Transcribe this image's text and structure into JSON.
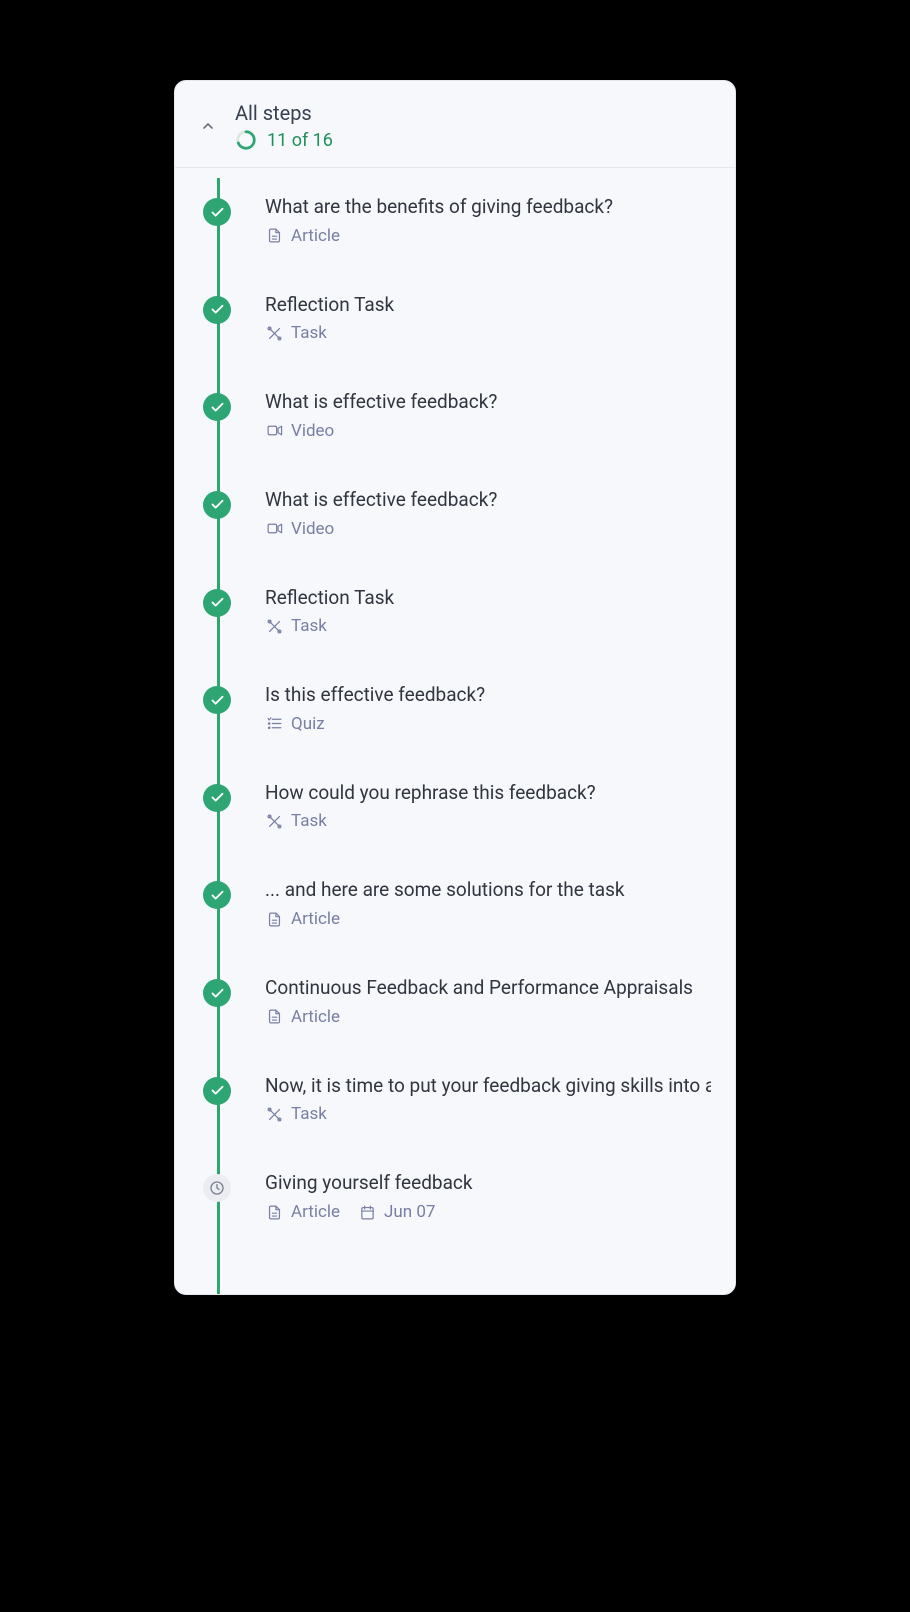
{
  "header": {
    "title": "All steps",
    "progress_label": "11 of 16",
    "progress_completed": 11,
    "progress_total": 16
  },
  "steps": [
    {
      "title": "What are the benefits of giving feedback?",
      "type": "Article",
      "status": "complete",
      "date": null
    },
    {
      "title": "Reflection Task",
      "type": "Task",
      "status": "complete",
      "date": null
    },
    {
      "title": "What is effective feedback?",
      "type": "Video",
      "status": "complete",
      "date": null
    },
    {
      "title": "What is effective feedback?",
      "type": "Video",
      "status": "complete",
      "date": null
    },
    {
      "title": "Reflection Task",
      "type": "Task",
      "status": "complete",
      "date": null
    },
    {
      "title": "Is this effective feedback?",
      "type": "Quiz",
      "status": "complete",
      "date": null
    },
    {
      "title": "How could you rephrase this feedback?",
      "type": "Task",
      "status": "complete",
      "date": null
    },
    {
      "title": "... and here are some solutions for the task",
      "type": "Article",
      "status": "complete",
      "date": null
    },
    {
      "title": "Continuous Feedback and Performance Appraisals",
      "type": "Article",
      "status": "complete",
      "date": null
    },
    {
      "title": "Now, it is time to put your feedback giving skills into ac",
      "type": "Task",
      "status": "complete",
      "date": null
    },
    {
      "title": "Giving yourself feedback",
      "type": "Article",
      "status": "pending",
      "date": "Jun 07"
    }
  ],
  "type_icons": {
    "Article": "document-icon",
    "Task": "tools-icon",
    "Video": "video-icon",
    "Quiz": "quiz-icon"
  },
  "colors": {
    "accent": "#2ea674",
    "muted": "#787fa3",
    "text": "#31353f",
    "card_bg": "#f6f8fb"
  }
}
